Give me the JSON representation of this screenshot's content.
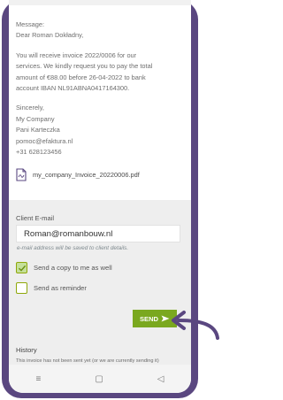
{
  "message": {
    "label": "Message:",
    "greeting": "Dear Roman Dokładny,",
    "body": [
      "You will receive invoice 2022/0006 for our",
      "services. We kindly request you to pay the total",
      "amount of €88.00 before 26-04-2022 to bank",
      "account IBAN NL91ABNA0417164300."
    ],
    "signoff": [
      "Sincerely,",
      "My Company",
      "Pani Karteczka",
      "pomoc@efaktura.nl",
      "+31 628123456"
    ]
  },
  "attachment": {
    "filename": "my_company_Invoice_20220006.pdf",
    "icon": "pdf-file-icon"
  },
  "form": {
    "email_label": "Client E-mail",
    "email_value": "Roman@romanbouw.nl",
    "email_hint": "e-mail address will be saved to client details.",
    "send_copy_label": "Send a copy to me as well",
    "send_copy_checked": true,
    "reminder_label": "Send as reminder",
    "reminder_checked": false,
    "send_label": "SEND"
  },
  "history": {
    "title": "History",
    "text": "This invoice has not been sent yet (or we are currently sending it)"
  },
  "nav": {
    "menu": "≡",
    "home": "▢",
    "back": "◁"
  },
  "colors": {
    "frame": "#5a4780",
    "accent": "#7aa81f",
    "checkbox_fill": "#c5e09a"
  }
}
